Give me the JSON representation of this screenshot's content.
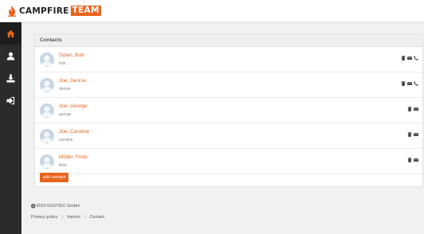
{
  "header": {
    "logo_part1": "CAMPFIRE",
    "logo_part2": "TEAM",
    "brand_color": "#e8641e"
  },
  "sidebar": {
    "items": [
      {
        "icon": "home-icon",
        "active": true
      },
      {
        "icon": "user-icon",
        "active": false
      },
      {
        "icon": "download-icon",
        "active": false
      },
      {
        "icon": "logout-icon",
        "active": false
      }
    ]
  },
  "contacts_panel": {
    "title": "Contacts",
    "contacts": [
      {
        "name": "Dylan, Bob",
        "username": "bob",
        "has_phone": true
      },
      {
        "name": "Joe, Denise",
        "username": "denise",
        "has_phone": true
      },
      {
        "name": "Joe, George",
        "username": "george",
        "has_phone": false
      },
      {
        "name": "Joe, Caroline",
        "username": "caroline",
        "has_phone": false
      },
      {
        "name": "Müller, Frida",
        "username": "frida",
        "has_phone": false
      }
    ],
    "add_button_label": "add contact"
  },
  "footer": {
    "copyright": "2020 EGOTEC GmbH",
    "links": [
      "Privacy policy",
      "Imprint",
      "Contact"
    ]
  }
}
